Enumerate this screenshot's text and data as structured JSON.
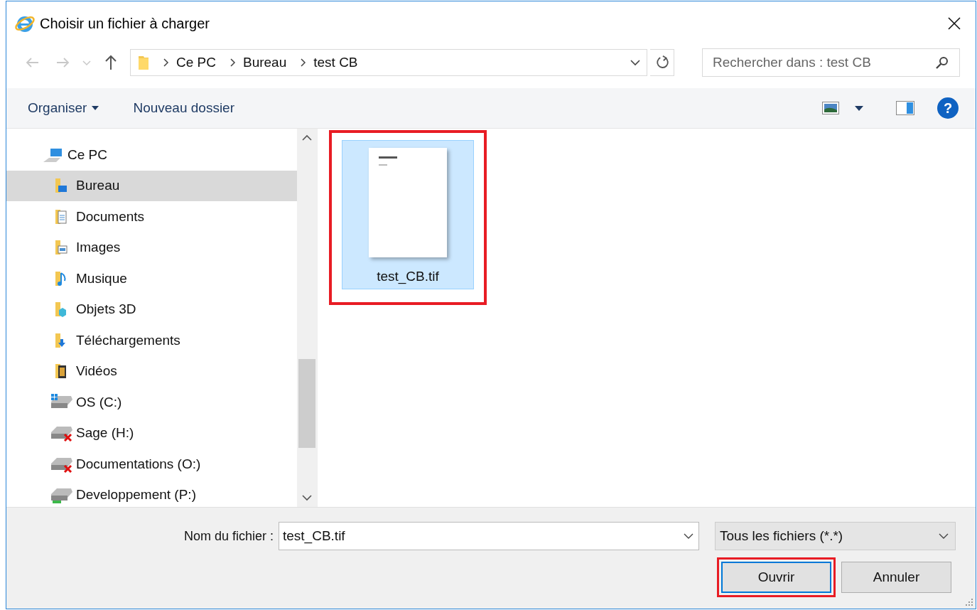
{
  "window": {
    "title": "Choisir un fichier à charger"
  },
  "address_bar": {
    "path": [
      "Ce PC",
      "Bureau",
      "test CB"
    ]
  },
  "search": {
    "placeholder": "Rechercher dans : test CB"
  },
  "toolbar": {
    "organize": "Organiser",
    "new_folder": "Nouveau dossier",
    "help": "?"
  },
  "sidebar": {
    "items": [
      {
        "label": "Ce PC",
        "kind": "pc",
        "selected": false,
        "children": [
          {
            "label": "Bureau",
            "kind": "desktop",
            "selected": true
          },
          {
            "label": "Documents",
            "kind": "documents",
            "selected": false
          },
          {
            "label": "Images",
            "kind": "pictures",
            "selected": false
          },
          {
            "label": "Musique",
            "kind": "music",
            "selected": false
          },
          {
            "label": "Objets 3D",
            "kind": "objects",
            "selected": false
          },
          {
            "label": "Téléchargements",
            "kind": "downloads",
            "selected": false
          },
          {
            "label": "Vidéos",
            "kind": "videos",
            "selected": false
          },
          {
            "label": "OS (C:)",
            "kind": "system-drive",
            "selected": false
          },
          {
            "label": "Sage (H:)",
            "kind": "disconnected-drive",
            "selected": false
          },
          {
            "label": "Documentations (O:)",
            "kind": "disconnected-drive",
            "selected": false
          },
          {
            "label": "Developpement (P:)",
            "kind": "network-drive",
            "selected": false
          }
        ]
      }
    ]
  },
  "files": [
    {
      "name": "test_CB.tif",
      "selected": true,
      "highlighted": true
    }
  ],
  "filename": {
    "label": "Nom du fichier :",
    "value": "test_CB.tif"
  },
  "filetype": {
    "value": "Tous les fichiers (*.*)"
  },
  "buttons": [
    {
      "label": "Ouvrir",
      "default": true,
      "highlighted": true
    },
    {
      "label": "Annuler",
      "default": false,
      "highlighted": false
    }
  ]
}
